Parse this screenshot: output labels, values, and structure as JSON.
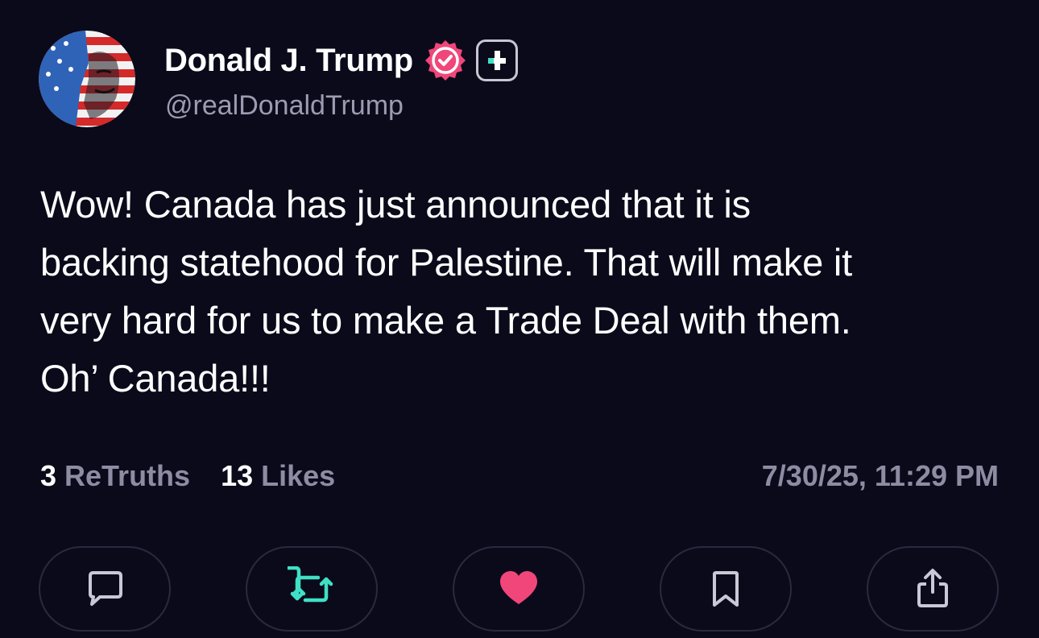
{
  "author": {
    "display_name": "Donald J. Trump",
    "handle": "@realDonaldTrump",
    "verified": true,
    "badge_color": "#f1467a",
    "plus_badge_color": "#3fe0c5"
  },
  "post": {
    "text": "Wow! Canada has just announced that it is\nbacking statehood for Palestine. That will make it\nvery hard for us to make a Trade Deal with them.\nOh’ Canada!!!"
  },
  "stats": {
    "retruths_count": "3",
    "retruths_label": "ReTruths",
    "likes_count": "13",
    "likes_label": "Likes",
    "timestamp": "7/30/25, 11:29 PM"
  },
  "actions": [
    {
      "icon": "comment-icon",
      "color": "#c9c8d6"
    },
    {
      "icon": "retruth-icon",
      "color": "#3fe0c5"
    },
    {
      "icon": "heart-icon",
      "color": "#f1467a",
      "active": true
    },
    {
      "icon": "bookmark-icon",
      "color": "#c9c8d6"
    },
    {
      "icon": "share-icon",
      "color": "#c9c8d6"
    }
  ],
  "colors": {
    "background": "#0b0a1a",
    "muted_text": "#8d8ca3",
    "accent_teal": "#3fe0c5",
    "accent_pink": "#f1467a"
  }
}
